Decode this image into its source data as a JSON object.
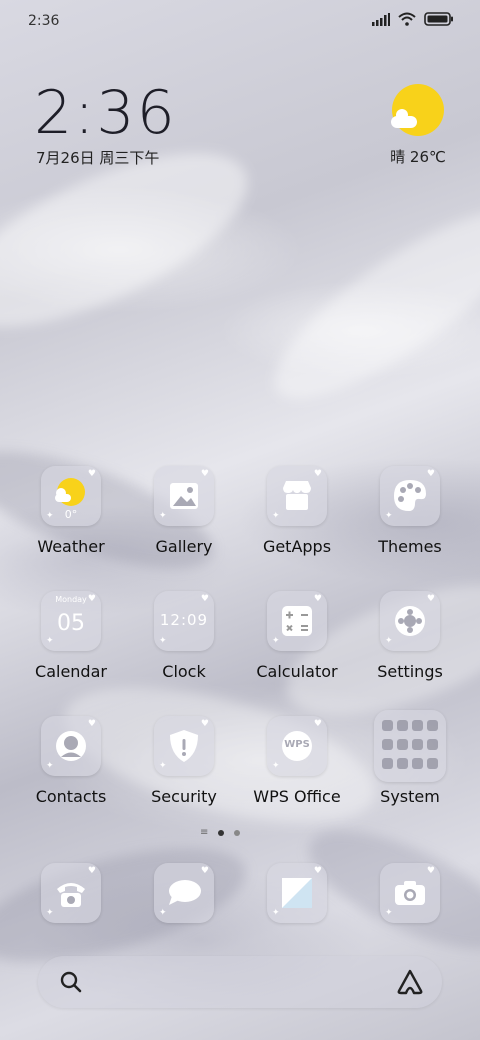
{
  "status_bar": {
    "time": "2:36"
  },
  "home_clock": {
    "time": "2:36",
    "date": "7月26日 周三下午"
  },
  "weather_widget": {
    "text": "晴 26℃",
    "sun_color": "#f8d21a"
  },
  "apps": [
    {
      "label": "Weather",
      "icon": "weather-icon",
      "detail": "0°"
    },
    {
      "label": "Gallery",
      "icon": "gallery-icon"
    },
    {
      "label": "GetApps",
      "icon": "getapps-icon"
    },
    {
      "label": "Themes",
      "icon": "themes-icon"
    },
    {
      "label": "Calendar",
      "icon": "calendar-icon",
      "detail": "05",
      "weekday": "Monday"
    },
    {
      "label": "Clock",
      "icon": "clock-icon",
      "detail": "12:09"
    },
    {
      "label": "Calculator",
      "icon": "calculator-icon"
    },
    {
      "label": "Settings",
      "icon": "settings-icon"
    },
    {
      "label": "Contacts",
      "icon": "contacts-icon"
    },
    {
      "label": "Security",
      "icon": "security-icon"
    },
    {
      "label": "WPS Office",
      "icon": "wps-office-icon",
      "detail": "WPS"
    },
    {
      "label": "System",
      "icon": "system-folder-icon"
    }
  ],
  "dock": [
    {
      "icon": "phone-icon"
    },
    {
      "icon": "messages-icon"
    },
    {
      "icon": "notes-icon"
    },
    {
      "icon": "camera-icon"
    }
  ],
  "pager": {
    "pages": 2,
    "current": 1
  },
  "search_bar": {
    "left_icon": "search-icon",
    "right_icon": "assistant-icon"
  }
}
